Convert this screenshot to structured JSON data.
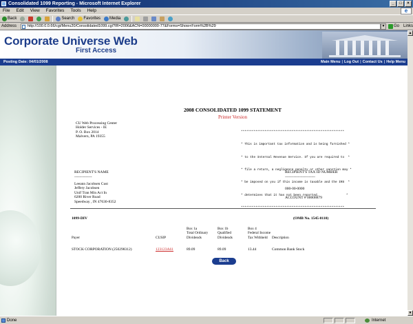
{
  "window": {
    "title": "Consolidated 1099 Reporting - Microsoft Internet Explorer"
  },
  "menu": [
    "File",
    "Edit",
    "View",
    "Favorites",
    "Tools",
    "Help"
  ],
  "toolbar": {
    "back": "Back",
    "search": "Search",
    "favorites": "Favorites",
    "media": "Media"
  },
  "address": {
    "label": "Address",
    "url": "http://100.0.0.66/cgi/Menu20/Consolidated1099.cgi?IR=2006&ACN=00000000-77&Forms=Show+Form%2B%29",
    "go": "Go",
    "links": "Links"
  },
  "banner": {
    "title": "Corporate Universe Web",
    "subtitle": "First Access"
  },
  "nav": {
    "posting_date": "Posting Date: 04/01/2008",
    "links": [
      "Main Menu",
      "Log Out",
      "Contact Us",
      "Help Menu"
    ]
  },
  "statement": {
    "title": "2008 CONSOLIDATED 1099 STATEMENT",
    "printer_version": "Printer Version",
    "from_address": [
      "CU Web Processing Center",
      "Holder Services - IE",
      "P. O. Box 2014",
      "Malvern, PA 19355"
    ],
    "notice_lines": [
      "*********************************************************",
      "* This is important tax information and is being furnished *",
      "* to the Internal Revenue Service. If you are required to  *",
      "* file a return, a negligence penalty or other sanction may *",
      "* be imposed on you if this income is taxable and the IRS  *",
      "* determines that it has not been reported.               *",
      "*********************************************************"
    ],
    "recipient_label": "RECIPIENT'S NAME",
    "recipient_dash": "--------------",
    "recipient_lines": [
      "Leeann Jacobsen Cust",
      "Jeffery Jacobsen",
      "Unif Tran Min Act In",
      "6200 River Road",
      "Speedway , IN 47630-8352"
    ],
    "tax_label": "RECIPIENT'S TAX ID NUMBER",
    "tax_dash": "------------------------",
    "tax_id": "000-00-0000",
    "account": "ACCOUNT # 00008879",
    "form_code": "1099-DIV",
    "omb": "(OMB No. 1545-0110)",
    "columns": {
      "payer": "Payer",
      "cusip": "CUSIP",
      "box1a": [
        "Box 1a",
        "Total Ordinary",
        "Dividends"
      ],
      "box1b": [
        "Box 1b",
        "Qualified",
        "Dividends"
      ],
      "box4": [
        "Box 4",
        "Federal Income",
        "Tax Withheld"
      ],
      "description": "Description"
    },
    "row": {
      "payer": "STOCK CORPORATION (250298312)",
      "cusip": "123123A61",
      "box1a": "89.09",
      "box1b": "89.09",
      "box4": "13.44",
      "description": "Common Bank Stock"
    },
    "back_button": "Back"
  },
  "status": {
    "left": "Done",
    "zone": "Internet"
  }
}
